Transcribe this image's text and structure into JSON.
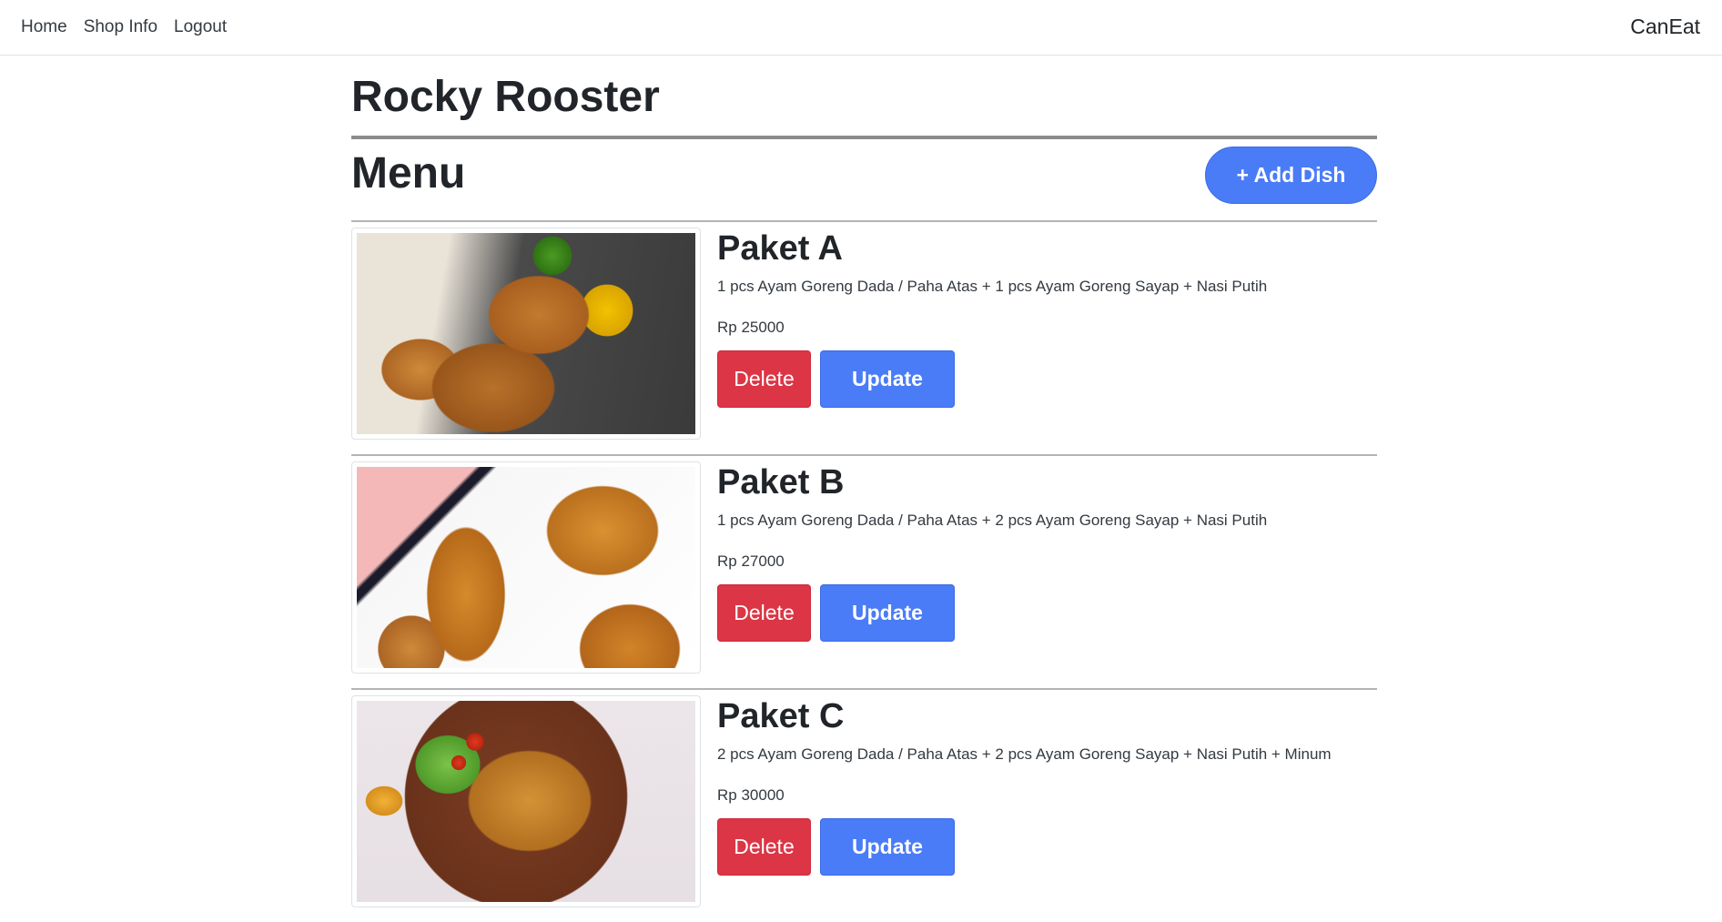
{
  "nav": {
    "links": [
      "Home",
      "Shop Info",
      "Logout"
    ],
    "brand": "CanEat"
  },
  "shop": {
    "name": "Rocky Rooster"
  },
  "menu": {
    "title": "Menu",
    "add_dish_label": "+ Add Dish",
    "dishes": [
      {
        "name": "Paket A",
        "description": "1 pcs Ayam Goreng Dada / Paha Atas + 1 pcs Ayam Goreng Sayap + Nasi Putih",
        "price": "Rp 25000",
        "delete_label": "Delete",
        "update_label": "Update"
      },
      {
        "name": "Paket B",
        "description": "1 pcs Ayam Goreng Dada / Paha Atas + 2 pcs Ayam Goreng Sayap + Nasi Putih",
        "price": "Rp 27000",
        "delete_label": "Delete",
        "update_label": "Update"
      },
      {
        "name": "Paket C",
        "description": "2 pcs Ayam Goreng Dada / Paha Atas + 2 pcs Ayam Goreng Sayap + Nasi Putih + Minum",
        "price": "Rp 30000",
        "delete_label": "Delete",
        "update_label": "Update"
      }
    ]
  },
  "colors": {
    "primary": "#4a7cf7",
    "danger": "#dc3545",
    "text": "#212529"
  }
}
